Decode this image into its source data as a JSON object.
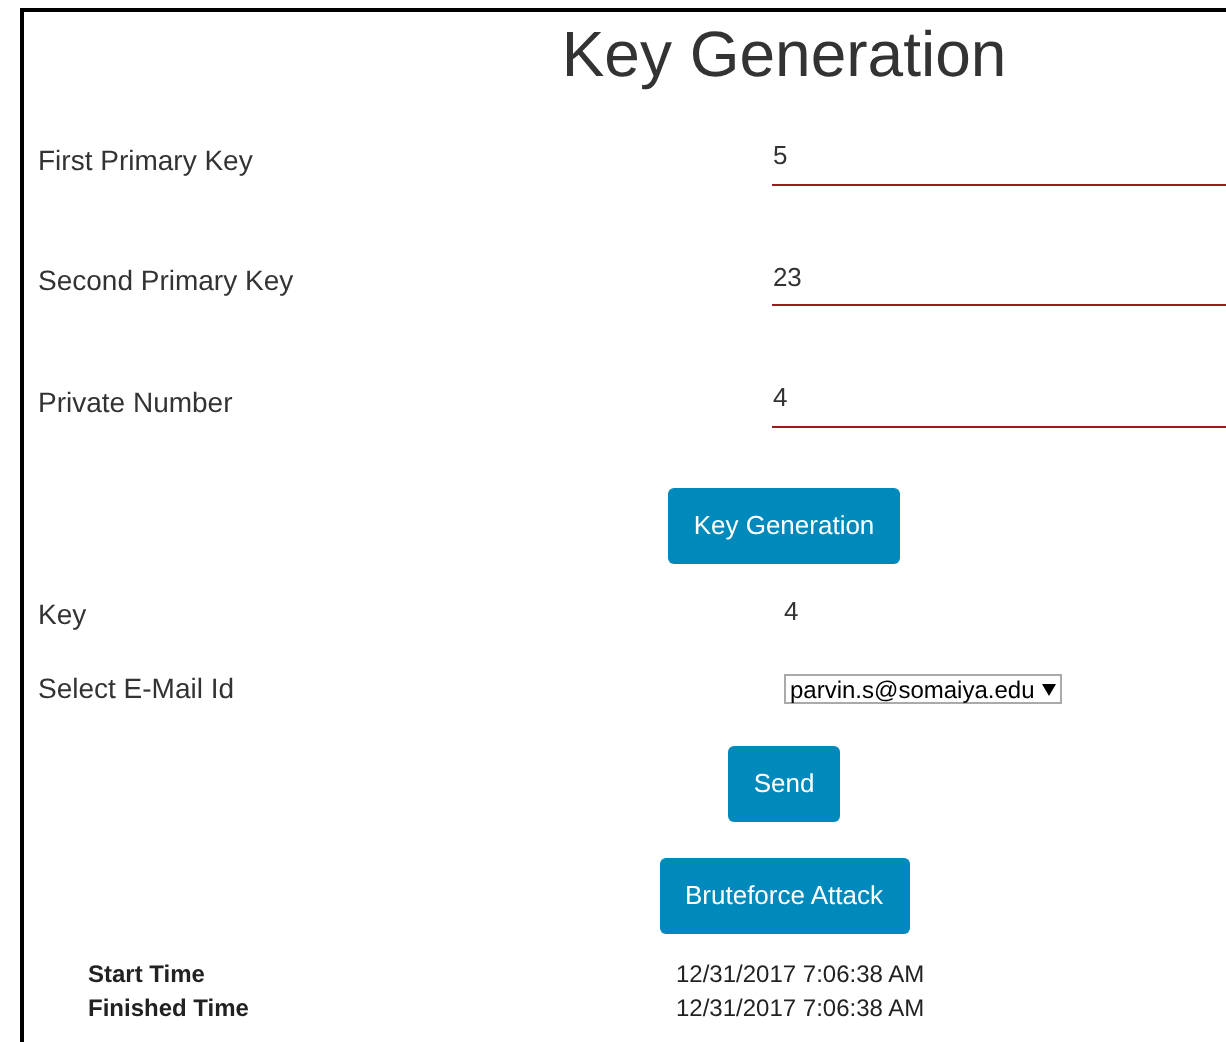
{
  "title": "Key Generation",
  "fields": [
    {
      "label": "First Primary Key",
      "value": "5"
    },
    {
      "label": "Second Primary Key",
      "value": "23"
    },
    {
      "label": "Private Number",
      "value": "4"
    }
  ],
  "key_generation_button": "Key Generation",
  "key": {
    "label": "Key",
    "value": "4"
  },
  "email": {
    "label": "Select E-Mail Id",
    "value": "parvin.s@somaiya.edu"
  },
  "send_button": "Send",
  "bruteforce_button": "Bruteforce Attack",
  "times": [
    {
      "label": "Start Time",
      "value": "12/31/2017 7:06:38 AM"
    },
    {
      "label": "Finished Time",
      "value": "12/31/2017 7:06:38 AM"
    }
  ]
}
